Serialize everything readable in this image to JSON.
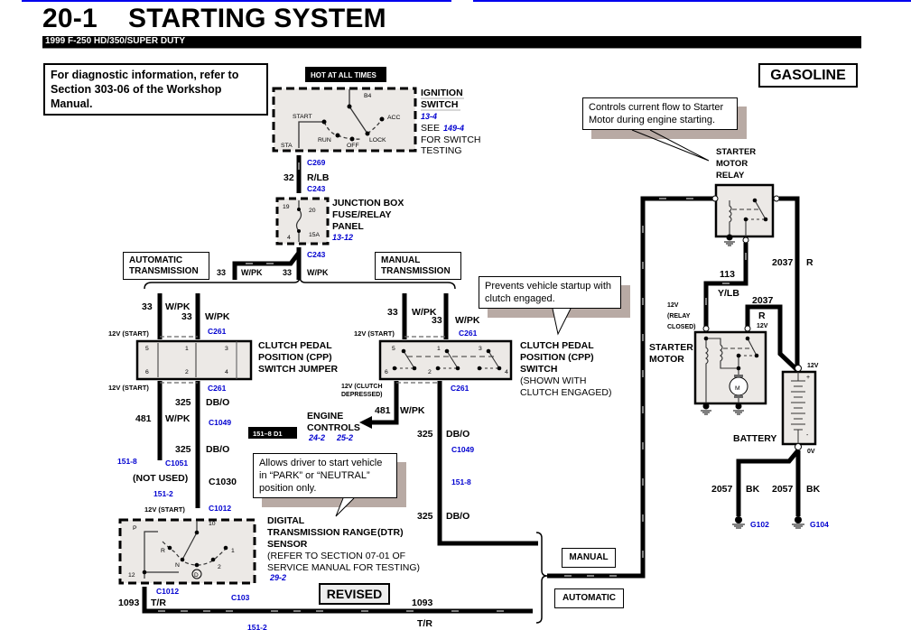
{
  "header": {
    "page_number": "20-1",
    "title": "STARTING SYSTEM",
    "vehicle": "1999 F-250 HD/350/SUPER DUTY"
  },
  "notes": {
    "diagnostic": "For diagnostic information, refer to Section 303-06 of the Workshop Manual.",
    "engine_type": "GASOLINE",
    "revised": "REVISED",
    "hot_at_all_times": "HOT AT ALL TIMES",
    "ref_badge": "151–8 D1"
  },
  "callouts": {
    "relay": "Controls current flow to Starter Motor during engine starting.",
    "clutch": "Prevents vehicle startup with clutch engaged.",
    "dtr": "Allows driver to start vehicle in “PARK” or “NEUTRAL” position only."
  },
  "transmission_labels": {
    "automatic_transmission": "AUTOMATIC TRANSMISSION",
    "manual_transmission": "MANUAL TRANSMISSION",
    "manual": "MANUAL",
    "automatic": "AUTOMATIC"
  },
  "components": {
    "ignition_switch": {
      "name_1": "IGNITION",
      "name_2": "SWITCH",
      "ref": "13-4",
      "see": "SEE",
      "see_ref": "149-4",
      "for_1": "FOR SWITCH",
      "for_2": "TESTING",
      "pins": {
        "b4": "B4",
        "start": "START",
        "acc": "ACC",
        "run": "RUN",
        "off": "OFF",
        "lock": "LOCK",
        "sta": "STA"
      }
    },
    "junction_box": {
      "name_1": "JUNCTION BOX",
      "name_2": "FUSE/RELAY",
      "name_3": "PANEL",
      "ref": "13-12",
      "pins": {
        "p19": "19",
        "p20": "20",
        "p4": "4",
        "fuse": "15A"
      }
    },
    "cpp_jumper": {
      "name_1": "CLUTCH PEDAL",
      "name_2": "POSITION (CPP)",
      "name_3": "SWITCH JUMPER",
      "pins": [
        "5",
        "1",
        "3",
        "6",
        "2",
        "4"
      ]
    },
    "cpp_switch": {
      "name_1": "CLUTCH PEDAL",
      "name_2": "POSITION (CPP)",
      "name_3": "SWITCH",
      "note_1": "(SHOWN WITH",
      "note_2": "CLUTCH ENGAGED)",
      "pins": [
        "5",
        "1",
        "3",
        "6",
        "2",
        "4"
      ]
    },
    "engine_controls": {
      "name_1": "ENGINE",
      "name_2": "CONTROLS",
      "ref_1": "24-2",
      "ref_2": "25-2"
    },
    "dtr_sensor": {
      "name_1": "DIGITAL",
      "name_2": "TRANSMISSION RANGE",
      "name_2b": "(DTR)",
      "name_3": "SENSOR",
      "note_1": "(REFER TO SECTION 07-01 OF",
      "note_2": "SERVICE MANUAL FOR TESTING)",
      "ref": "29-2",
      "pins": {
        "p": "P",
        "r": "R",
        "n": "N",
        "d": "D",
        "p2": "2",
        "p1": "1",
        "p10": "10",
        "p12": "12"
      }
    },
    "starter_relay": {
      "name_1": "STARTER",
      "name_2": "MOTOR",
      "name_3": "RELAY"
    },
    "starter_motor": {
      "name_1": "STARTER",
      "name_2": "MOTOR",
      "motor": "M"
    },
    "battery": {
      "name": "BATTERY",
      "plus": "+",
      "minus": "-",
      "v12": "12V",
      "v0": "0V"
    }
  },
  "wires": {
    "w32": {
      "circuit": "32",
      "color": "R/LB"
    },
    "w33": {
      "circuit": "33",
      "color": "W/PK"
    },
    "w481": {
      "circuit": "481",
      "color": "W/PK"
    },
    "w325": {
      "circuit": "325",
      "color": "DB/O"
    },
    "w1093": {
      "circuit": "1093",
      "color": "T/R"
    },
    "w113": {
      "circuit": "113",
      "color": "Y/LB"
    },
    "w2037": {
      "circuit": "2037",
      "color": "R"
    },
    "w2057": {
      "circuit": "2057",
      "color": "BK"
    }
  },
  "connectors": {
    "c269": "C269",
    "c243": "C243",
    "c261": "C261",
    "c1049": "C1049",
    "c1051": "C1051",
    "c1030": "C1030",
    "c1012": "C1012",
    "c103": "C103",
    "g102": "G102",
    "g104": "G104"
  },
  "page_refs": {
    "r151_8": "151-8",
    "r151_2": "151-2"
  },
  "voltage_labels": {
    "start_12v": "12V (START)",
    "clutch_1": "12V (CLUTCH",
    "clutch_2": "DEPRESSED)",
    "relay_1": "12V",
    "relay_2": "(RELAY",
    "relay_3": "CLOSED)",
    "v12": "12V",
    "not_used": "(NOT USED)"
  }
}
